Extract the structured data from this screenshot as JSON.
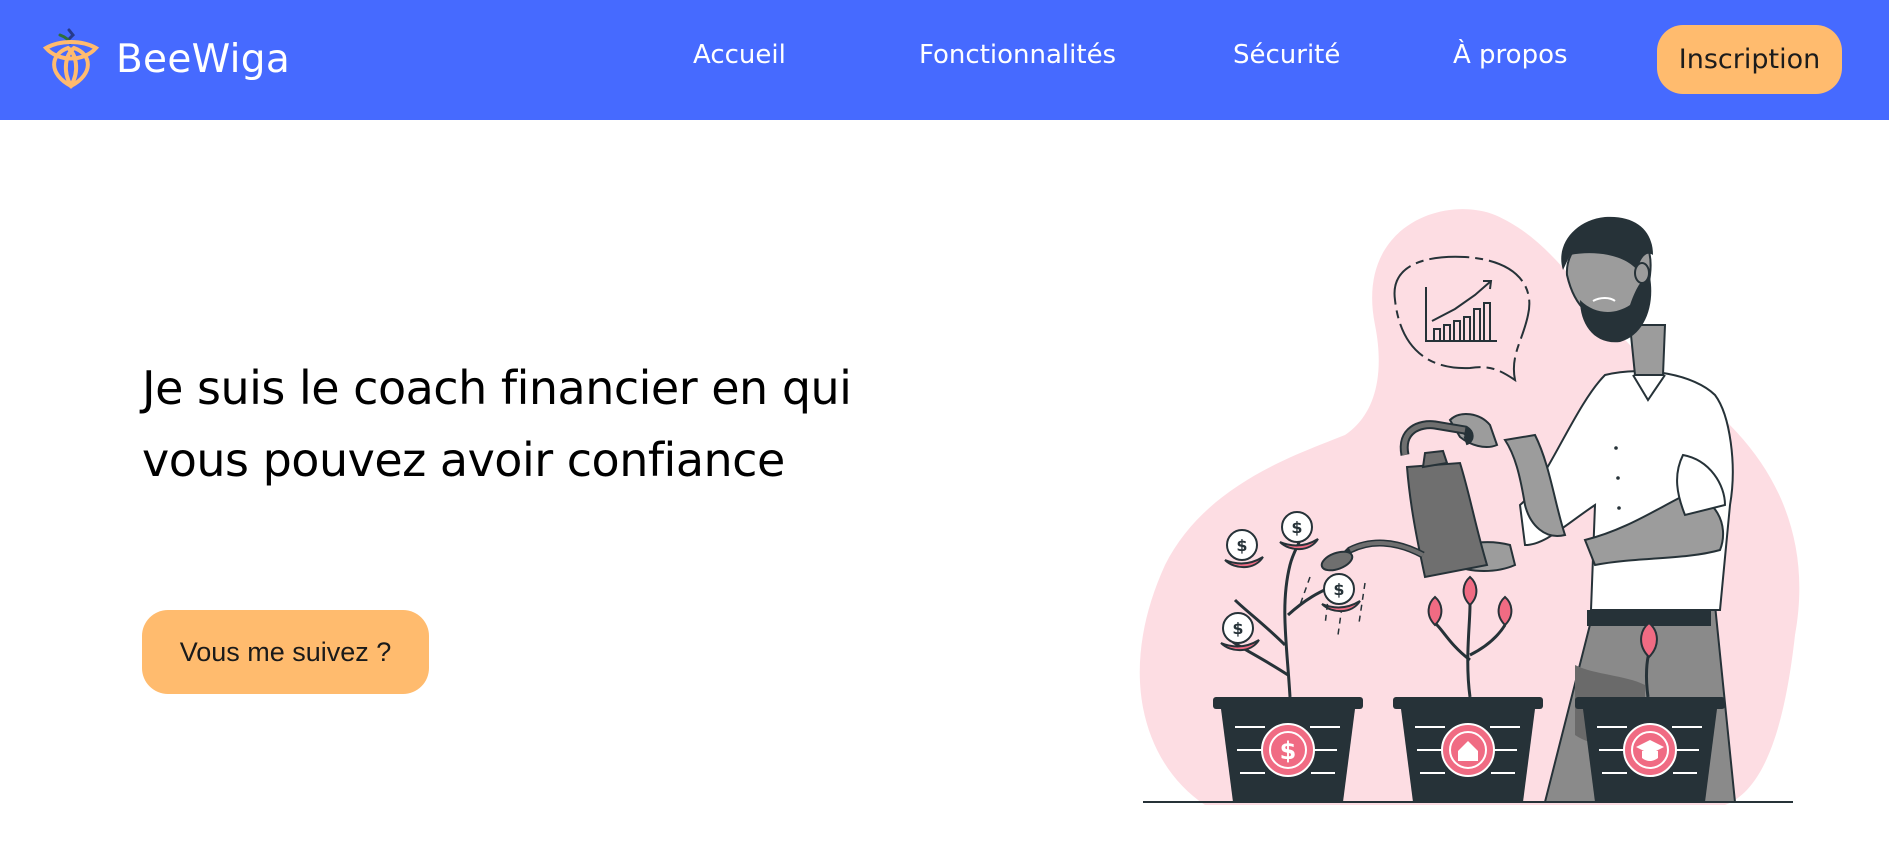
{
  "header": {
    "brand": "BeeWiga",
    "logo_icon": "bee-trefoil-logo-icon",
    "nav": [
      {
        "label": "Accueil"
      },
      {
        "label": "Fonctionnalités"
      },
      {
        "label": "Sécurité"
      },
      {
        "label": "À propos"
      }
    ],
    "cta_label": "Inscription"
  },
  "hero": {
    "title": "Je suis le coach financier en qui vous pouvez avoir confiance",
    "cta_label": "Vous me suivez ?"
  },
  "illustration": {
    "icon": "man-watering-money-plants-illustration",
    "pots": [
      "dollar-icon",
      "house-icon",
      "graduation-cap-icon"
    ]
  },
  "colors": {
    "nav_bg": "#466aff",
    "accent": "#ffbb6e",
    "blob": "#fddde3",
    "pink": "#f06b83",
    "dark": "#263238"
  }
}
